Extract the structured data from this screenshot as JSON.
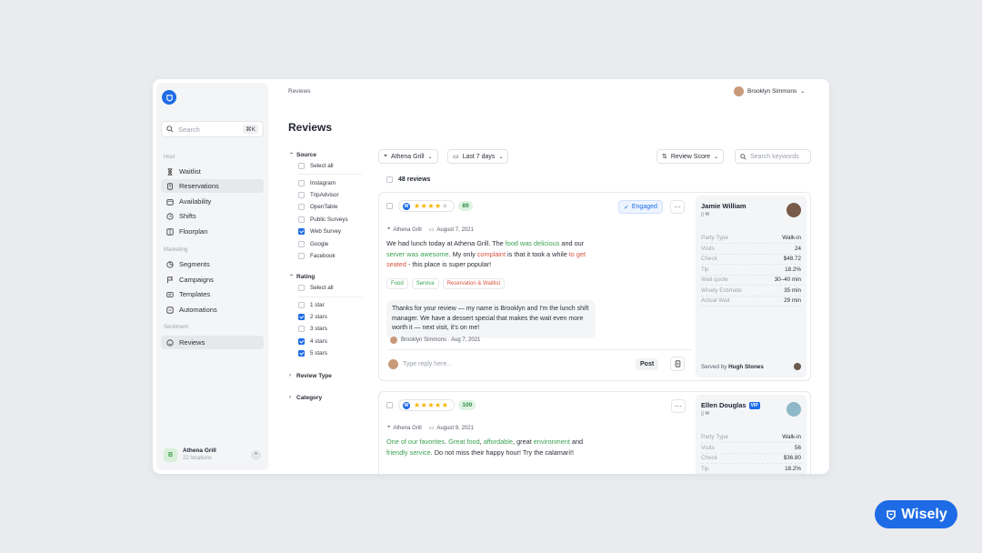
{
  "sidebar": {
    "search_placeholder": "Search",
    "search_shortcut": "⌘K",
    "sections": {
      "host": "Host",
      "marketing": "Marketing",
      "sentiment": "Sentiment"
    },
    "items": [
      {
        "label": "Waitlist",
        "icon": "hourglass-icon"
      },
      {
        "label": "Reservations",
        "icon": "book-icon"
      },
      {
        "label": "Availability",
        "icon": "calendar-icon"
      },
      {
        "label": "Shifts",
        "icon": "clock-icon"
      },
      {
        "label": "Floorplan",
        "icon": "layout-icon"
      },
      {
        "label": "Segments",
        "icon": "pie-icon"
      },
      {
        "label": "Campaigns",
        "icon": "flag-icon"
      },
      {
        "label": "Templates",
        "icon": "template-icon"
      },
      {
        "label": "Automations",
        "icon": "automation-icon"
      },
      {
        "label": "Reviews",
        "icon": "smile-icon"
      }
    ],
    "account": {
      "initial": "B",
      "name": "Athena Grill",
      "sub": "22 locations"
    }
  },
  "header": {
    "breadcrumb": "Reviews",
    "user": "Brooklyn Simmons",
    "title": "Reviews"
  },
  "filters": {
    "source": {
      "title": "Source",
      "options": [
        "Select all",
        "Instagram",
        "TripAdvisor",
        "OpenTable",
        "Public Surveys",
        "Web Survey",
        "Google",
        "Facebook"
      ]
    },
    "rating": {
      "title": "Rating",
      "options": [
        "Select all",
        "1 star",
        "2 stars",
        "3 stars",
        "4 stars",
        "5 stars"
      ]
    },
    "review_type": "Review Type",
    "category": "Category"
  },
  "toolbar": {
    "location": "Athena Grill",
    "range": "Last 7 days",
    "sort": "Review Score",
    "keywords_placeholder": "Search keywords",
    "count": "48 reviews"
  },
  "reviews": [
    {
      "score": "89",
      "status": "Engaged",
      "location": "Athena Grill",
      "date": "August 7, 2021",
      "tags": [
        "Food",
        "Service",
        "Reservation & Waitlist"
      ],
      "reply": "Thanks for your review — my name is Brooklyn and I'm the lunch shift manager. We have a dessert special that makes the wait even more worth it — next visit, it's on me!",
      "reply_meta": "Brooklyn Simmons · Aug 7, 2021",
      "reply_placeholder": "Type reply here...",
      "post": "Post",
      "customer": {
        "name": "Jamie William",
        "rows": [
          [
            "Party Type",
            "Walk-in"
          ],
          [
            "Visits",
            "24"
          ],
          [
            "Check",
            "$48.72"
          ],
          [
            "Tip",
            "18.2%"
          ],
          [
            "Wait quote",
            "30–40 min"
          ],
          [
            "Wisely Estimate",
            "35 min"
          ],
          [
            "Actual Wait",
            "29 min"
          ]
        ],
        "served_label": "Served by",
        "served_by": "Hugh Stones"
      }
    },
    {
      "score": "100",
      "location": "Athena Grill",
      "date": "August 9, 2021",
      "customer": {
        "name": "Ellen Douglas",
        "badge": "VIP",
        "rows": [
          [
            "Party Type",
            "Walk-in"
          ],
          [
            "Visits",
            "56"
          ],
          [
            "Check",
            "$36.80"
          ],
          [
            "Tip",
            "18.2%"
          ]
        ]
      }
    }
  ],
  "brand": "Wisely",
  "colors": {
    "accent": "#1e6be6",
    "positive": "#3aa14f",
    "negative": "#d6533f"
  }
}
